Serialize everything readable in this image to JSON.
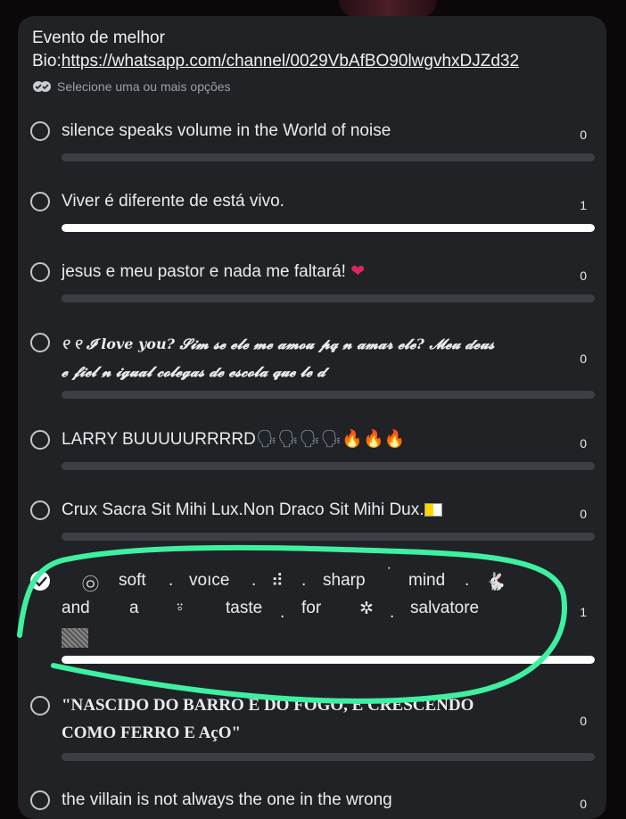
{
  "poll": {
    "question_prefix": "Evento de melhor Bio:",
    "question_link": "https://whatsapp.com/channel/0029VbAfBO90lwgvhxDJZd32",
    "hint": "Selecione uma ou mais opções",
    "hint_icon": "double-check-icon"
  },
  "options": [
    {
      "label": "silence speaks volume in the World of noise",
      "count": "0",
      "fill": 0
    },
    {
      "label": "Viver é diferente de está vivo.",
      "count": "1",
      "fill": 1
    },
    {
      "label": "jesus e meu pastor e nada me faltará! ",
      "emoji": "❤",
      "count": "0",
      "fill": 0
    },
    {
      "label_line1": "୧ ୧ 𝓘 love you? 𝓢𝓲𝓶 𝓼𝓮 𝓮𝓵𝓮 𝓶𝓮 𝓪𝓶𝓸𝓾 𝓹𝓺 𝓷 𝓪𝓶𝓪𝓻 𝓮𝓵𝓮? 𝓜𝓮𝓾 𝓭𝓮𝓾𝓼",
      "label_line2": "𝓮 𝓯𝓲𝓮𝓵 𝓷 𝓲𝓰𝓾𝓪𝓵 𝓬𝓸𝓵𝓮𝓰𝓪𝓼 𝓭𝓮 𝓮𝓼𝓬𝓸𝓵𝓪 𝓺𝓾𝓮 𝓵𝓮 𝓭",
      "count": "0",
      "fill": 0
    },
    {
      "label": "LARRY BUUUUURRRRD",
      "emoji_bubbles": "🗣🗣🗣🗣",
      "emoji_fire": "🔥🔥🔥",
      "count": "0",
      "fill": 0
    },
    {
      "label": "Crux Sacra Sit Mihi Lux.Non Draco Sit Mihi Dux.",
      "count": "0",
      "fill": 0
    },
    {
      "words_line1": [
        "㉧",
        "soft",
        ".",
        "voıce",
        ".",
        "⠾",
        ".",
        "sharp",
        "˙",
        "mind",
        ".",
        "🐇"
      ],
      "words_line2": [
        "and",
        "a",
        "⍤",
        "taste",
        ".",
        "for",
        "✲",
        ".",
        "salvatore"
      ],
      "count": "1",
      "fill": 1,
      "selected": true
    },
    {
      "label_line1": "\"NASCIDO DO BARRO E DO FOGO, E CRESCENDO",
      "label_line2": "COMO FERRO E AçO\"",
      "count": "0",
      "fill": 0
    },
    {
      "label": "the villain is not always the one in the wrong",
      "count": "0",
      "fill": 0
    }
  ],
  "colors": {
    "card": "#202226",
    "bar_track": "#3b3e42",
    "bar_fill": "#ffffff",
    "annotation": "#3ef0a0"
  }
}
